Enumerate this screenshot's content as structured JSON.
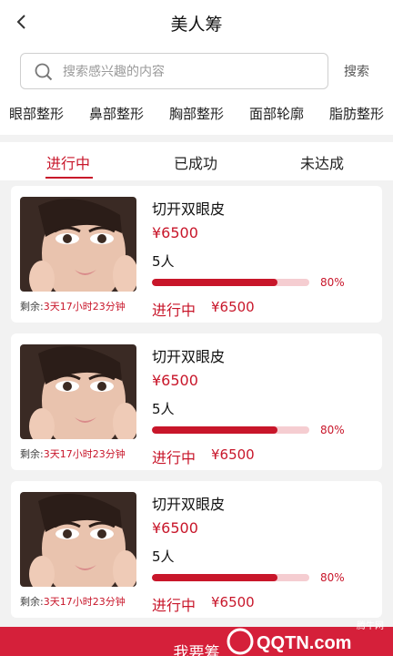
{
  "header": {
    "title": "美人筹",
    "back_icon": "chevron-left-icon"
  },
  "search": {
    "placeholder": "搜索感兴趣的内容",
    "button_label": "搜索",
    "icon": "search-icon"
  },
  "categories": [
    "眼部整形",
    "鼻部整形",
    "胸部整形",
    "面部轮廓",
    "脂肪整形"
  ],
  "tabs": [
    {
      "label": "进行中",
      "active": true
    },
    {
      "label": "已成功",
      "active": false
    },
    {
      "label": "未达成",
      "active": false
    }
  ],
  "remain_label": "剩余:",
  "items": [
    {
      "name": "切开双眼皮",
      "price": "¥6500",
      "people": "5人",
      "progress": 0.8,
      "progress_label": "80%",
      "remaining": "3天17小时23分钟",
      "status": "进行中",
      "status_price": "¥6500"
    },
    {
      "name": "切开双眼皮",
      "price": "¥6500",
      "people": "5人",
      "progress": 0.8,
      "progress_label": "80%",
      "remaining": "3天17小时23分钟",
      "status": "进行中",
      "status_price": "¥6500"
    },
    {
      "name": "切开双眼皮",
      "price": "¥6500",
      "people": "5人",
      "progress": 0.8,
      "progress_label": "80%",
      "remaining": "3天17小时23分钟",
      "status": "进行中",
      "status_price": "¥6500"
    }
  ],
  "bottom_button": {
    "label": "我要筹"
  },
  "watermark": {
    "cn": "腾牛网",
    "en": "QQTN.com"
  },
  "colors": {
    "accent": "#c8162a",
    "button": "#d5203a",
    "progress_track": "#f5cdd1"
  }
}
